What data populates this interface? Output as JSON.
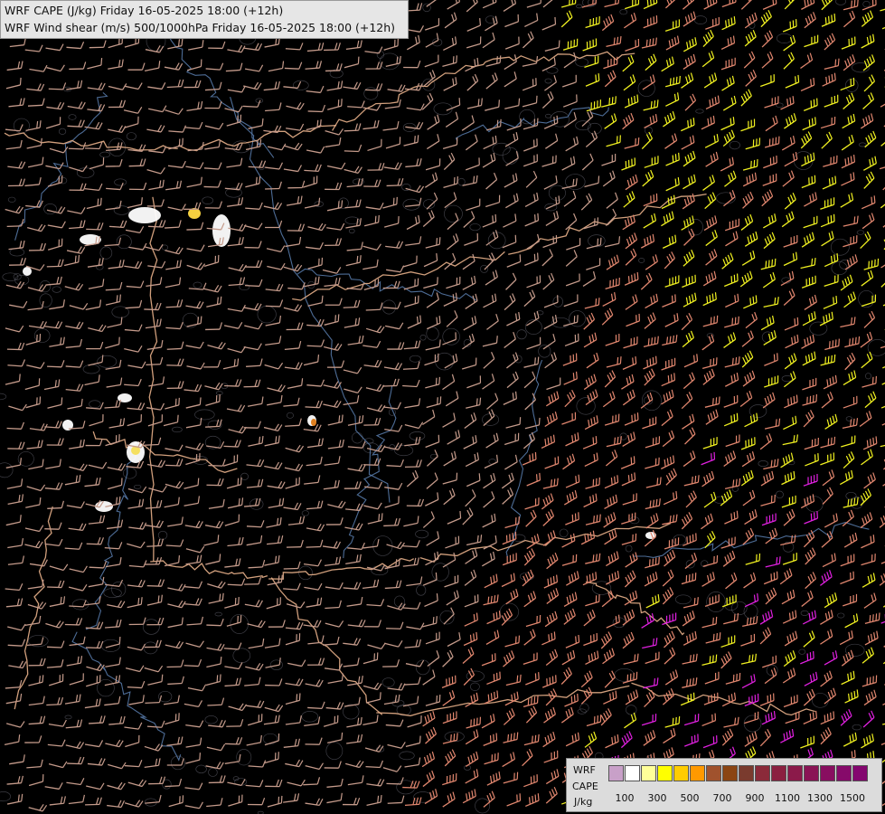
{
  "header": {
    "line1": "WRF CAPE (J/kg) Friday 16-05-2025 18:00 (+12h)",
    "line2": "WRF Wind shear (m/s) 500/1000hPa Friday 16-05-2025 18:00 (+12h)"
  },
  "legend": {
    "model": "WRF",
    "variable": "CAPE",
    "unit": "J/kg",
    "colors": [
      "#c8a0c8",
      "#ffffff",
      "#ffff99",
      "#ffff00",
      "#ffcc00",
      "#ff9900",
      "#a0522d",
      "#8b4513",
      "#7a3b2e",
      "#8b2a3a",
      "#8b2040",
      "#8b1a4a",
      "#8a1455",
      "#880e60",
      "#860a6a",
      "#84066f"
    ],
    "tick_labels": [
      "100",
      "300",
      "500",
      "700",
      "900",
      "1100",
      "1300",
      "1500"
    ]
  },
  "map_colors": {
    "background": "#000000",
    "borders": "#e8b08a",
    "rivers": "#5a7fb0",
    "barb_low": "#c49a8a",
    "barb_mid": "#e0866e",
    "barb_magenta": "#e020e0",
    "barb_yellow": "#f0f020",
    "cape_white": "#ffffff"
  }
}
